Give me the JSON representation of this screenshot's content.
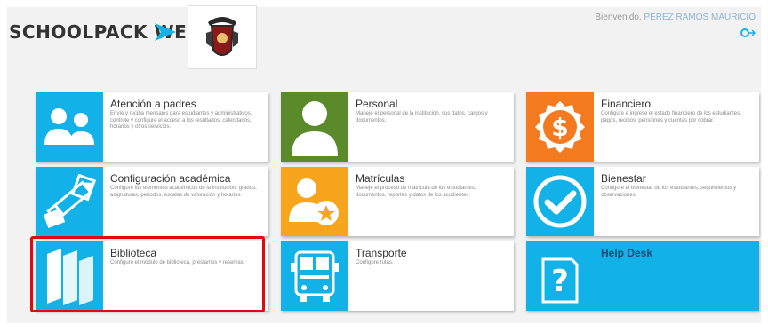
{
  "header": {
    "brand": "SCHOOLPACK WEB",
    "welcome_label": "Bienvenido,",
    "user_name": "PEREZ RAMOS MAURICIO"
  },
  "colors": {
    "blue": "#12b2e8",
    "green": "#5a8a2a",
    "orange": "#f47a1f",
    "highlight": "#e30613"
  },
  "tiles": [
    {
      "title": "Atención a padres",
      "desc": "Envíe y reciba mensajes para estudiantes y administrativos, controle y configure el acceso a los resultados, calendarios, horarios y otros servicios.",
      "icon": "parents-icon"
    },
    {
      "title": "Personal",
      "desc": "Maneje el personal de la institución, sus datos, cargos y documentos.",
      "icon": "person-icon"
    },
    {
      "title": "Financiero",
      "desc": "Configure e ingrese el estado financiero de los estudiantes, pagos, recibos, pensiones y cuentas por cobrar.",
      "icon": "money-icon"
    },
    {
      "title": "Configuración académica",
      "desc": "Configure los elementos académicos de la institución: grados, asignaturas, periodos, escalas de valoración y horarios.",
      "icon": "academic-config-icon"
    },
    {
      "title": "Matrículas",
      "desc": "Maneje el proceso de matrícula de los estudiantes, documentos, reportes y datos de los acudientes.",
      "icon": "enrollment-icon"
    },
    {
      "title": "Bienestar",
      "desc": "Configure el bienestar de los estudiantes, seguimientos y observaciones.",
      "icon": "wellbeing-icon"
    },
    {
      "title": "Biblioteca",
      "desc": "Configure el módulo de biblioteca, préstamos y reservas.",
      "icon": "library-icon"
    },
    {
      "title": "Transporte",
      "desc": "Configure rutas.",
      "icon": "bus-icon"
    },
    {
      "title": "Help Desk",
      "desc": "",
      "icon": "help-icon"
    }
  ]
}
